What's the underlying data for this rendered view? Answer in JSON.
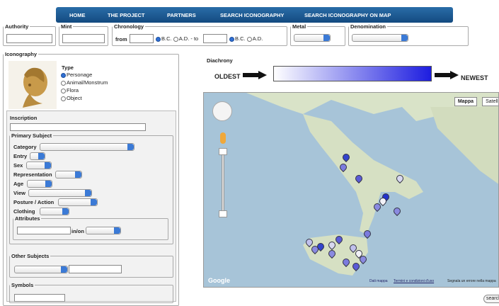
{
  "nav": {
    "items": [
      "HOME",
      "THE PROJECT",
      "PARTNERS",
      "SEARCH ICONOGRAPHY",
      "SEARCH ICONOGRAPHY ON MAP"
    ]
  },
  "filters": {
    "authority": "Authority",
    "mint": "Mint",
    "chronology": "Chronology",
    "from": "from",
    "bc": "B.C.",
    "ad": "A.D.",
    "to": "- to",
    "metal": "Metal",
    "denomination": "Denomination"
  },
  "icon": {
    "legend": "Iconography",
    "type": "Type",
    "types": [
      "Personage",
      "Animal/Monstrum",
      "Flora",
      "Object"
    ]
  },
  "inscription": "Inscription",
  "primary": {
    "legend": "Primary Subject",
    "fields": [
      "Category",
      "Entry",
      "Sex",
      "Representation",
      "Age",
      "View",
      "Posture / Action",
      "Clothing"
    ],
    "attributes": "Attributes",
    "inon": "in/on"
  },
  "other": "Other Subjects",
  "symbols": "Symbols",
  "diachrony": {
    "legend": "Diachrony",
    "oldest": "OLDEST",
    "newest": "NEWEST"
  },
  "map": {
    "mappa": "Mappa",
    "satellite": "Satellite",
    "google": "Google",
    "footer1": "Dati mappa",
    "footer2": "Termini e condizioni d'uso",
    "footer3": "Segnala un errore nella mappa"
  },
  "search": "search"
}
